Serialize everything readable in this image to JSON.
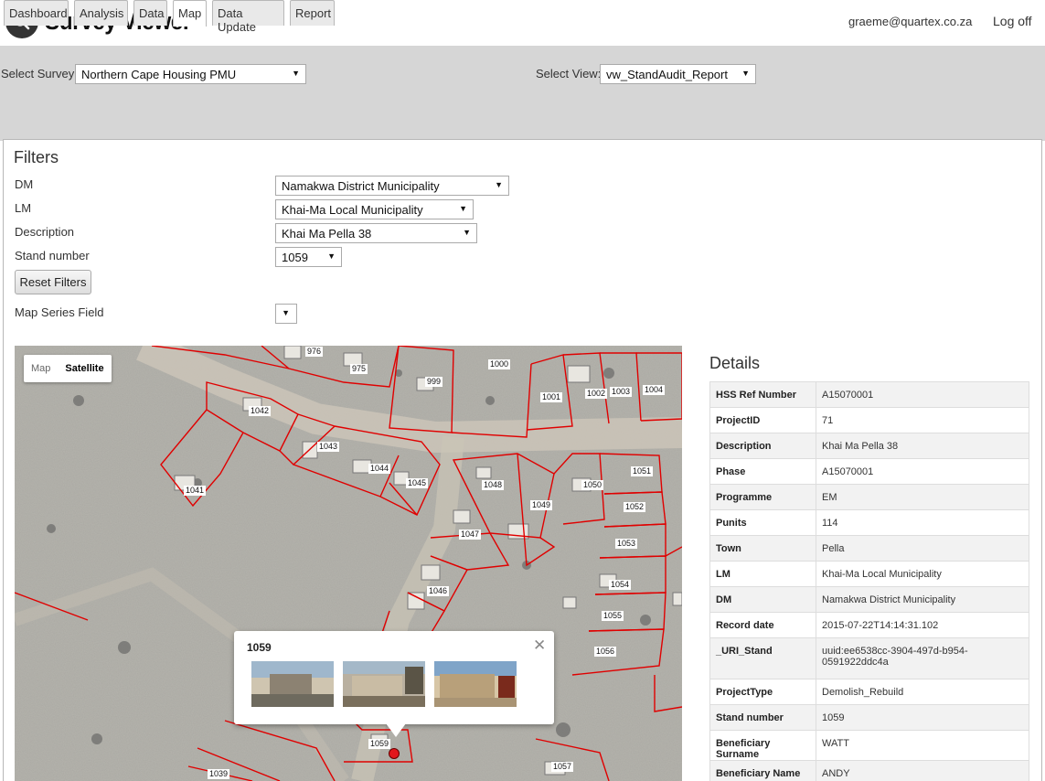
{
  "header": {
    "app_title": "Survey Viewer",
    "user_email": "graeme@quartex.co.za",
    "logoff_label": "Log off"
  },
  "survey_select": {
    "label": "Select Survey:",
    "value": "Northern Cape Housing PMU"
  },
  "view_select": {
    "label": "Select View:",
    "value": "vw_StandAudit_Report"
  },
  "tabs": [
    {
      "label": "Dashboard"
    },
    {
      "label": "Analysis"
    },
    {
      "label": "Data"
    },
    {
      "label": "Map",
      "active": true
    },
    {
      "label": "Data Update"
    },
    {
      "label": "Report"
    }
  ],
  "filters": {
    "title": "Filters",
    "dm": {
      "label": "DM",
      "value": "Namakwa District Municipality"
    },
    "lm": {
      "label": "LM",
      "value": "Khai-Ma Local Municipality"
    },
    "description": {
      "label": "Description",
      "value": "Khai Ma Pella 38"
    },
    "stand_number": {
      "label": "Stand number",
      "value": "1059"
    },
    "reset_label": "Reset Filters",
    "map_series": {
      "label": "Map Series Field",
      "value": ""
    }
  },
  "map": {
    "type_map_label": "Map",
    "type_satellite_label": "Satellite",
    "stand_labels": [
      "976",
      "975",
      "999",
      "1000",
      "1001",
      "1002",
      "1003",
      "1004",
      "1042",
      "1043",
      "1044",
      "1045",
      "1041",
      "1048",
      "1049",
      "1050",
      "1051",
      "1052",
      "1047",
      "1053",
      "1046",
      "1054",
      "1055",
      "1056",
      "1059",
      "1057",
      "1039"
    ],
    "popup": {
      "title": "1059",
      "close_icon": "close-icon"
    },
    "marker_color": "#e3171d",
    "parcel_line_color": "#e00000"
  },
  "details": {
    "title": "Details",
    "rows": [
      {
        "key": "HSS Ref Number",
        "value": "A15070001"
      },
      {
        "key": "ProjectID",
        "value": "71"
      },
      {
        "key": "Description",
        "value": "Khai Ma Pella 38"
      },
      {
        "key": "Phase",
        "value": "A15070001"
      },
      {
        "key": "Programme",
        "value": "EM"
      },
      {
        "key": "Punits",
        "value": "114"
      },
      {
        "key": "Town",
        "value": "Pella"
      },
      {
        "key": "LM",
        "value": "Khai-Ma Local Municipality"
      },
      {
        "key": "DM",
        "value": "Namakwa District Municipality"
      },
      {
        "key": "Record date",
        "value": "2015-07-22T14:14:31.102"
      },
      {
        "key": "_URI_Stand",
        "value": "uuid:ee6538cc-3904-497d-b954-0591922ddc4a"
      },
      {
        "key": "ProjectType",
        "value": "Demolish_Rebuild"
      },
      {
        "key": "Stand number",
        "value": "1059"
      },
      {
        "key": "Beneficiary Surname",
        "value": "WATT"
      },
      {
        "key": "Beneficiary Name",
        "value": "ANDY"
      }
    ]
  }
}
